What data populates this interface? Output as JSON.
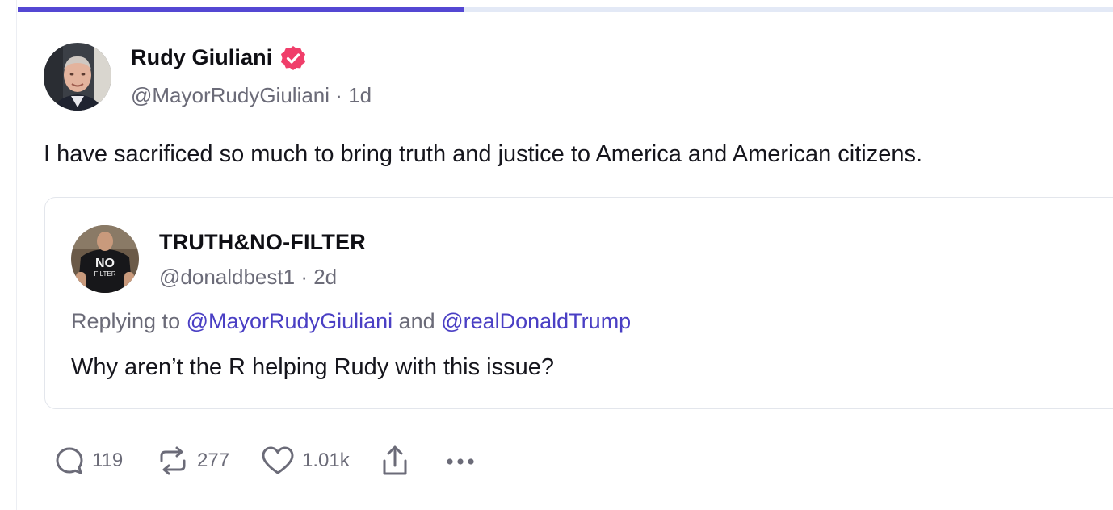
{
  "progress": {
    "fraction": 0.408,
    "fill_color": "#5447d3",
    "track_color": "#e3e9f6"
  },
  "post": {
    "author": {
      "name": "Rudy Giuliani",
      "handle": "@MayorRudyGiuliani",
      "time": "1d",
      "verified": true,
      "verified_color": "#f03e6a",
      "avatar_icon": "avatar-photo"
    },
    "text": "I have sacrificed so much to bring truth and justice to America and American citizens."
  },
  "quote": {
    "author": {
      "name": "TRUTH&NO-FILTER",
      "handle": "@donaldbest1",
      "time": "2d",
      "avatar_icon": "avatar-photo",
      "avatar_text_top": "NO",
      "avatar_text_bottom": "FILTER"
    },
    "replying_prefix": "Replying to",
    "replying_to": [
      "@MayorRudyGiuliani",
      "@realDonaldTrump"
    ],
    "replying_joiner": "and",
    "text": "Why aren’t the R helping Rudy with this issue?"
  },
  "actions": {
    "replies": {
      "icon": "reply-icon",
      "count": "119"
    },
    "retruths": {
      "icon": "retruth-icon",
      "count": "277"
    },
    "likes": {
      "icon": "heart-icon",
      "count": "1.01k"
    },
    "share": {
      "icon": "share-icon"
    },
    "more": {
      "icon": "more-icon"
    }
  },
  "separator": "·"
}
